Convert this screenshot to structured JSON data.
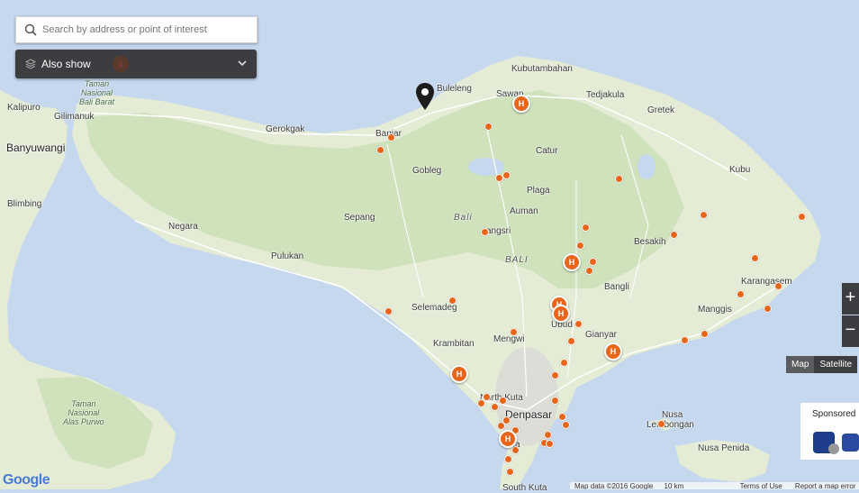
{
  "search": {
    "placeholder": "Search by address or point of interest"
  },
  "also_show": {
    "label": "Also show"
  },
  "zoom": {
    "in_label": "+",
    "out_label": "−"
  },
  "map_type": {
    "map_label": "Map",
    "satellite_label": "Satellite"
  },
  "sponsored": {
    "label": "Sponsored"
  },
  "attribution": {
    "map_data": "Map data ©2016 Google",
    "scale": "10 km",
    "terms": "Terms of Use",
    "report": "Report a map error"
  },
  "places": [
    {
      "id": "kalipuro",
      "text": "Kalipuro"
    },
    {
      "id": "gilimanuk",
      "text": "Gilimanuk"
    },
    {
      "id": "banyuwangi",
      "text": "Banyuwangi"
    },
    {
      "id": "blimbing",
      "text": "Blimbing"
    },
    {
      "id": "gerokgak",
      "text": "Gerokgak"
    },
    {
      "id": "banjar",
      "text": "Banjar"
    },
    {
      "id": "buleleng",
      "text": "Buleleng"
    },
    {
      "id": "kubutambahan",
      "text": "Kubutambahan"
    },
    {
      "id": "sawan",
      "text": "Sawan"
    },
    {
      "id": "tejakula",
      "text": "Tedjakula"
    },
    {
      "id": "gretek",
      "text": "Gretek"
    },
    {
      "id": "kubu",
      "text": "Kubu"
    },
    {
      "id": "catur",
      "text": "Catur"
    },
    {
      "id": "gobleg",
      "text": "Gobleg"
    },
    {
      "id": "plaga",
      "text": "Plaga"
    },
    {
      "id": "bali_it",
      "text": "Bali"
    },
    {
      "id": "auman",
      "text": "Auman"
    },
    {
      "id": "sepang",
      "text": "Sepang"
    },
    {
      "id": "negara",
      "text": "Negara"
    },
    {
      "id": "angsri",
      "text": "angsri"
    },
    {
      "id": "bali_region",
      "text": "BALI"
    },
    {
      "id": "besakih",
      "text": "Besakih"
    },
    {
      "id": "pulukan",
      "text": "Pulukan"
    },
    {
      "id": "karangasem",
      "text": "Karangasem"
    },
    {
      "id": "bangli",
      "text": "Bangli"
    },
    {
      "id": "selemadeg",
      "text": "Selemadeg"
    },
    {
      "id": "manggis",
      "text": "Manggis"
    },
    {
      "id": "ubud",
      "text": "Ubud"
    },
    {
      "id": "mengwi",
      "text": "Mengwi"
    },
    {
      "id": "gianyar",
      "text": "Gianyar"
    },
    {
      "id": "krambitan",
      "text": "Krambitan"
    },
    {
      "id": "north_kuta",
      "text": "North Kuta"
    },
    {
      "id": "denpasar",
      "text": "Denpasar"
    },
    {
      "id": "nusa",
      "text": "Nusa"
    },
    {
      "id": "lembongan",
      "text": "Lembongan"
    },
    {
      "id": "kuta",
      "text": "Kuta"
    },
    {
      "id": "nusa_penida",
      "text": "Nusa Penida"
    },
    {
      "id": "south_kuta",
      "text": "South Kuta"
    }
  ],
  "parks": [
    {
      "id": "bali_barat",
      "lines": [
        "Taman",
        "Nasional",
        "Bali Barat"
      ]
    },
    {
      "id": "alas_purwo",
      "lines": [
        "Taman",
        "Nasional",
        "Alas Purwo"
      ]
    }
  ],
  "google_logo": "Google",
  "colors": {
    "water": "#c6d8ee",
    "land": "#e4ecd6",
    "forest": "#cfe2bc",
    "marker": "#e8661c",
    "panel": "#3b3d40"
  }
}
